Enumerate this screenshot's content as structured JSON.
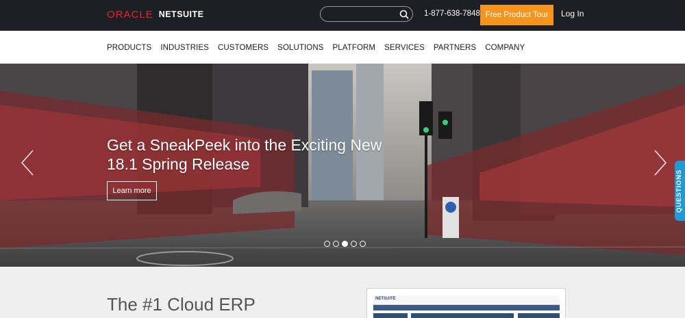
{
  "header": {
    "logo_oracle": "ORACLE",
    "logo_netsuite": "NETSUITE",
    "search_placeholder": "",
    "phone": "1-877-638-7848",
    "tour_button": "Free Product Tour",
    "login": "Log In"
  },
  "nav": {
    "items": [
      {
        "label": "PRODUCTS"
      },
      {
        "label": "INDUSTRIES"
      },
      {
        "label": "CUSTOMERS"
      },
      {
        "label": "SOLUTIONS"
      },
      {
        "label": "PLATFORM"
      },
      {
        "label": "SERVICES"
      },
      {
        "label": "PARTNERS"
      },
      {
        "label": "COMPANY"
      }
    ]
  },
  "hero": {
    "title": "Get a SneakPeek into the Exciting New 18.1 Spring Release",
    "button": "Learn more",
    "slides_total": 5,
    "active_slide": 3
  },
  "questions_tab": "QUESTIONS",
  "section": {
    "title": "The #1 Cloud ERP",
    "preview_logo": "NETSUITE"
  },
  "colors": {
    "topbar": "#1e1f24",
    "accent_orange": "#f7941e",
    "oracle_red": "#e8242b",
    "questions_blue": "#1e9ad6"
  }
}
